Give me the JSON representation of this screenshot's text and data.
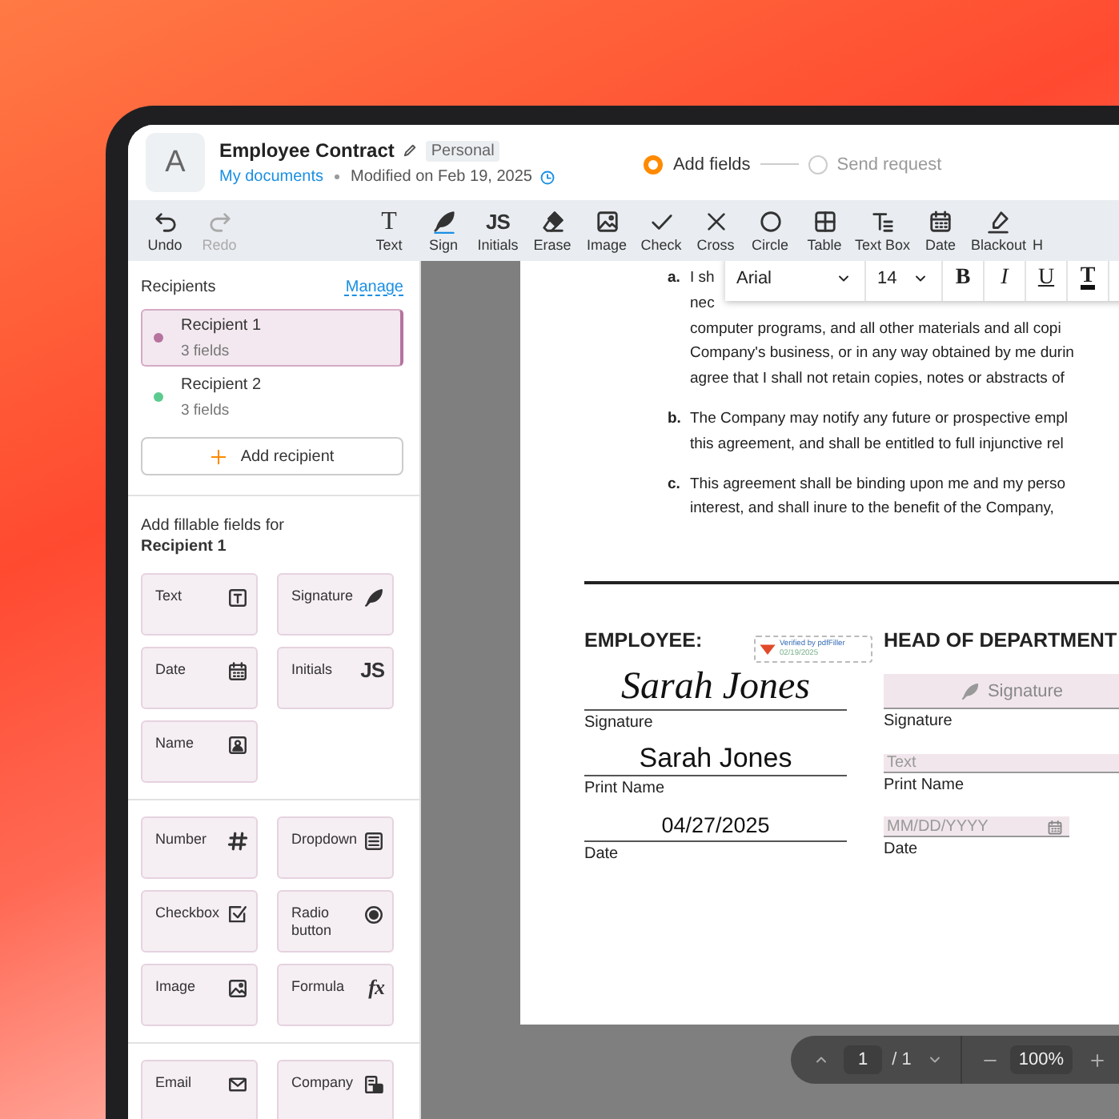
{
  "document_header": {
    "avatar": "A",
    "title": "Employee Contract",
    "badge": "Personal",
    "breadcrumb_link": "My documents",
    "modified": "Modified on Feb 19, 2025"
  },
  "steps": [
    {
      "label": "Add fields",
      "selected": true
    },
    {
      "label": "Send request",
      "selected": false
    }
  ],
  "toolbar": {
    "history": [
      {
        "label": "Undo",
        "kind": "undo",
        "disabled": false
      },
      {
        "label": "Redo",
        "kind": "redo",
        "disabled": true
      }
    ],
    "tools": [
      {
        "label": "Text",
        "kind": "text",
        "glyph": "T"
      },
      {
        "label": "Sign",
        "kind": "sign"
      },
      {
        "label": "Initials",
        "kind": "initials",
        "glyph": "JS"
      },
      {
        "label": "Erase",
        "kind": "erase"
      },
      {
        "label": "Image",
        "kind": "image"
      },
      {
        "label": "Check",
        "kind": "check"
      },
      {
        "label": "Cross",
        "kind": "cross"
      },
      {
        "label": "Circle",
        "kind": "circle"
      },
      {
        "label": "Table",
        "kind": "table"
      },
      {
        "label": "Text Box",
        "kind": "textbox"
      },
      {
        "label": "Date",
        "kind": "date"
      },
      {
        "label": "Blackout",
        "kind": "blackout"
      },
      {
        "label": "H",
        "kind": "partial"
      }
    ]
  },
  "sidebar": {
    "heading": "Recipients",
    "manage": "Manage",
    "recipients": [
      {
        "name": "Recipient 1",
        "fields": "3 fields",
        "color": "#b5739e",
        "selected": true
      },
      {
        "name": "Recipient 2",
        "fields": "3 fields",
        "color": "#5ccb8f",
        "selected": false
      }
    ],
    "add_button": "Add recipient",
    "fields_heading": "Add fillable fields for **Recipient 1**",
    "field_groups": [
      {
        "fields": [
          {
            "label": "Text",
            "kind": "text"
          },
          {
            "label": "Signature",
            "kind": "signature"
          },
          {
            "label": "Date",
            "kind": "date"
          },
          {
            "label": "Initials",
            "kind": "initials",
            "glyph": "JS"
          },
          {
            "label": "Name",
            "kind": "name"
          }
        ]
      },
      {
        "fields": [
          {
            "label": "Number",
            "kind": "number"
          },
          {
            "label": "Dropdown",
            "kind": "dropdown"
          },
          {
            "label": "Checkbox",
            "kind": "checkbox"
          },
          {
            "label": "Radio button",
            "kind": "radio"
          },
          {
            "label": "Image",
            "kind": "image"
          },
          {
            "label": "Formula",
            "kind": "formula",
            "glyph": "fx"
          }
        ]
      },
      {
        "fields": [
          {
            "label": "Email",
            "kind": "email"
          },
          {
            "label": "Company",
            "kind": "company"
          }
        ]
      }
    ]
  },
  "format_bar": {
    "font": "Arial",
    "size": "14",
    "buttons": [
      {
        "glyph": "B",
        "kind": "bold"
      },
      {
        "glyph": "I",
        "kind": "italic"
      },
      {
        "glyph": "U",
        "kind": "underline"
      },
      {
        "glyph": "T",
        "kind": "color"
      }
    ]
  },
  "document": {
    "clauses": [
      {
        "marker": "a.",
        "lines": [
          "I sh",
          "nec",
          "computer programs, and all other materials and all copi",
          "Company's business, or in any way obtained by me durin",
          "agree that I shall not retain copies, notes or abstracts of"
        ]
      },
      {
        "marker": "b.",
        "lines": [
          "The Company may notify any future or prospective empl",
          "this agreement, and shall be entitled to full injunctive rel"
        ]
      },
      {
        "marker": "c.",
        "lines": [
          "This agreement shall be binding upon me and my perso",
          "interest, and shall inure to the benefit of the Company,"
        ]
      }
    ],
    "verified_stamp": {
      "text": "Verified by pdfFiller",
      "date": "02/19/2025"
    },
    "employee": {
      "heading": "EMPLOYEE:",
      "signature": "Sarah Jones",
      "signature_label": "Signature",
      "print_name": "Sarah Jones",
      "print_label": "Print Name",
      "date": "04/27/2025",
      "date_label": "Date"
    },
    "department": {
      "heading": "HEAD OF DEPARTMENT",
      "signature_placeholder": "Signature",
      "signature_label": "Signature",
      "name_placeholder": "Text",
      "print_label": "Print Name",
      "date_placeholder": "MM/DD/YYYY",
      "date_label": "Date"
    }
  },
  "pager": {
    "page": "1",
    "total": "/ 1",
    "zoom": "100%"
  }
}
